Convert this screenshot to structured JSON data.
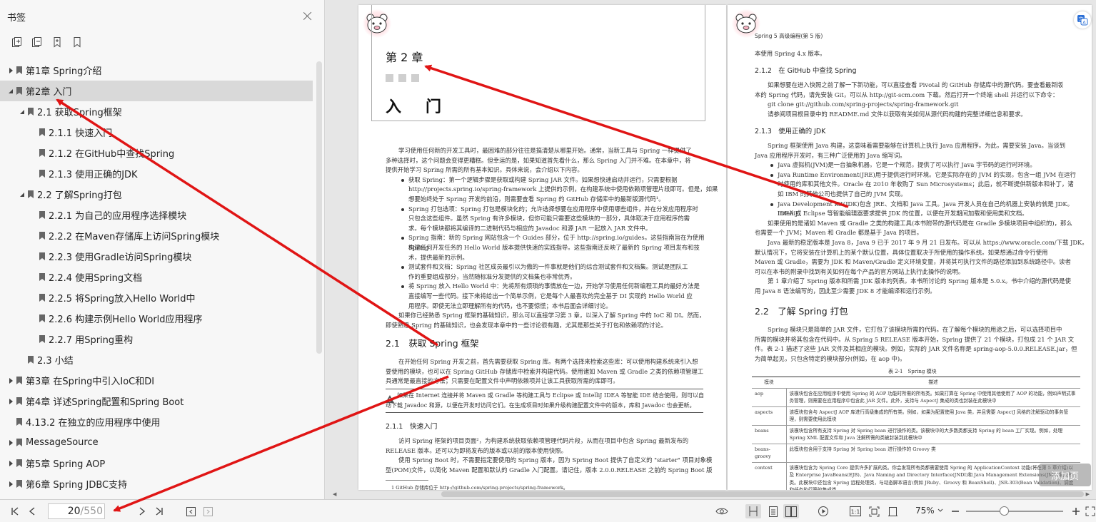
{
  "sidebar": {
    "title": "书签",
    "items": [
      {
        "label": "第1章 Spring介绍",
        "level": 0,
        "caret": "right"
      },
      {
        "label": "第2章 入门",
        "level": 0,
        "caret": "down",
        "selected": true
      },
      {
        "label": "2.1 获取Spring框架",
        "level": 1,
        "caret": "down"
      },
      {
        "label": "2.1.1 快速入门",
        "level": 2,
        "caret": ""
      },
      {
        "label": "2.1.2 在GitHub中查找Spring",
        "level": 2,
        "caret": ""
      },
      {
        "label": "2.1.3 使用正确的JDK",
        "level": 2,
        "caret": ""
      },
      {
        "label": "2.2 了解Spring打包",
        "level": 1,
        "caret": "down"
      },
      {
        "label": "2.2.1 为自己的应用程序选择模块",
        "level": 2,
        "caret": ""
      },
      {
        "label": "2.2.2 在Maven存储库上访问Spring模块",
        "level": 2,
        "caret": ""
      },
      {
        "label": "2.2.3 使用Gradle访问Spring模块",
        "level": 2,
        "caret": ""
      },
      {
        "label": "2.2.4 使用Spring文档",
        "level": 2,
        "caret": ""
      },
      {
        "label": "2.2.5 将Spring放入Hello World中",
        "level": 2,
        "caret": ""
      },
      {
        "label": "2.2.6 构建示例Hello World应用程序",
        "level": 2,
        "caret": ""
      },
      {
        "label": "2.2.7 用Spring重构",
        "level": 2,
        "caret": ""
      },
      {
        "label": "2.3 小结",
        "level": 1,
        "caret": ""
      },
      {
        "label": "第3章 在Spring中引入IoC和DI",
        "level": 0,
        "caret": "right"
      },
      {
        "label": "第4章 详述Spring配置和Spring Boot",
        "level": 0,
        "caret": "right"
      },
      {
        "label": "4.13.2 在独立的应用程序中使用",
        "level": 0.5,
        "caret": ""
      },
      {
        "label": "MessageSource",
        "level": 0,
        "caret": "right"
      },
      {
        "label": "第5章 Spring AOP",
        "level": 0,
        "caret": "right"
      },
      {
        "label": "第6章 Spring JDBC支持",
        "level": 0,
        "caret": "right"
      }
    ]
  },
  "left_page": {
    "chapter_no": "第 2 章",
    "chapter_title": "入门",
    "intro": [
      "学习使用任何新的开发工具时，最困难的部分往往是搞清楚从哪里开始。通常，当新工具与 Spring 一样提供了",
      "多种选择时，这个问题会变得更糟糕。但幸运的是，如果知道首先看什么，那么 Spring 入门并不难。在本章中，将",
      "提供开始学习 Spring 所需的所有基本知识。具体来说，会介绍以下内容。"
    ],
    "bullets": [
      [
        "获取 Spring：第一个逻辑步骤是获取或构建 Spring JAR 文件。如果想快速启动并运行，只需要根据",
        "http://projects.spring.io/spring-framework 上提供的示例，在构建系统中使用依赖项管理片段即可。但是，如果",
        "想要始终处于 Spring 开发的前沿，则需要查看 Spring 的 GitHub 存储库中的最新版源代码¹。"
      ],
      [
        "Spring 打包选项：Spring 打包是模块化的；允许选择想要在应用程序中使用哪些组件，并在分发应用程序时",
        "只包含这些组件。虽然 Spring 有许多模块，但你可能只需要这些模块的一部分，具体取决于应用程序的需",
        "求。每个模块都将其编译的二进制代码与相应的 Javadoc 和源 JAR 一起放入 JAR 文件中。"
      ],
      [
        "Spring 指南：新的 Spring 网站包含一个 Guides 部分，位于 http://spring.io/guides。这些指南旨在为使用 Spring",
        "构建任何开发任务的 Hello World 版本提供快速的实践指导。这些指南还反映了最新的 Spring 项目发布和技",
        "术，提供最新的示例。"
      ],
      [
        "测试套件和文档：Spring 社区成员最引以为傲的一件事就是他们的综合测试套件和文档集。测试是团队工",
        "作的重要组成部分，当然随标准分发提供的文档集也非常优秀。"
      ],
      [
        "将 Spring 放入 Hello World 中：先将所有烦琐的事情放在一边，开始学习使用任何新编程工具的最好方法是",
        "直接编写一些代码。接下来将给出一个简单示例，它是每个人最喜欢的完全基于 DI 实现的 Hello World 应",
        "用程序。即使无法立即理解所有的代码，也不要惊慌；本书后面会详细讨论。"
      ]
    ],
    "outro": [
      "如果你已经熟悉 Spring 框架的基础知识，那么可以直接学习第 3 章，以深入了解 Spring 中的 IoC 和 DI。然而，",
      "即使熟悉 Spring 的基础知识，也会发现本章中的一些讨论很有趣，尤其是那些关于打包和依赖项的讨论。"
    ],
    "h_21": "2.1　获取 Spring 框架",
    "p_21": [
      "在开始任何 Spring 开发之前，首先需要获取 Spring 库。有两个选择来检索这些库：可以使用构建系统来引入想",
      "要使用的模块，也可以在 Spring GitHub 存储库中检索并构建代码。使用诸如 Maven 或 Gradle 之类的依赖项管理工",
      "具通常是最直接的方法；只需要在配置文件中声明依赖项并让该工具获取所需的库即可。"
    ],
    "note": [
      "如果在 Internet 连接并将 Maven 或 Gradle 等构建工具与 Eclipse 或 IntelliJ IDEA 等智能 IDE 结合使用，则可以自",
      "动下载 Javadoc 和源，以便在开发时访问它们。在生成项目时如果升级构建配置文件中的版本，库和 Javadoc 也会更新。"
    ],
    "h_211": "2.1.1　快速入门",
    "p_211": [
      "访问 Spring 框架的项目页面²，为构建系统获取依赖项管理代码片段，从而在项目中包含 Spring 最新发布的",
      "RELEASE 版本。还可以为即将发布的版本或以前的版本使用快照。",
      "使用 Spring Boot 时，不需要指定要使用的 Spring 版本，因为 Spring Boot 提供了自定义的 \"starter\" 项目对象模",
      "型(POM)文件，以简化 Maven 配置和默认的 Gradle 入门配置。请记住，版本 2.0.0.RELEASE 之前的 Spring Boot 版"
    ],
    "footnote": "1  GitHub 存储库位于 http://github.com/spring-projects/spring-framework。"
  },
  "right_page": {
    "header": "Spring 5 高级编程(第 5 版)",
    "top_line": "本使用 Spring 4.x 版本。",
    "h_212": "2.1.2　在 GitHub 中查找 Spring",
    "p_212": [
      "如果想要在进入快照之前了解一下新功能，可以直接查看 Pivotal 的 GitHub 存储库中的源代码。要查看最新版",
      "本的 Spring 代码，请先安装 Git，可以从 http://git-scm.com 下载。然后打开一个终端 shell 并运行以下命令：",
      "git clone git://github.com/spring-projects/spring-framework.git",
      "请参阅项目根目录中的 README.md 文件以获取有关如何从源代码构建的完整详细信息和要求。"
    ],
    "h_213": "2.1.3　使用正确的 JDK",
    "p_213a": [
      "Spring 框架使用 Java 构建，这意味着需要能够在计算机上执行 Java 应用程序。为此，需要安装 Java。当谈到",
      "Java 应用程序开发时，有三种广泛使用的 Java 缩写词。"
    ],
    "bullets": [
      [
        "Java 虚拟机(JVM)是一台抽象机器。它是一个规范，提供了可以执行 Java 字节码的运行时环境。"
      ],
      [
        "Java Runtime Environment(JRE)用于提供运行时环境。它是实际存在的 JVM 的实现，包含一组 JVM 在运行",
        "时使用的库和其他文件。Oracle 在 2010 年收购了 Sun Microsystems；此后，就不断提供新版本和补丁，诸",
        "如 IBM 的其他公司也提供了自己的 JVM 实现。"
      ],
      [
        "Java Development Kit(JDK)包含 JRE、文档和 Java 工具。Java 开发人员在自己的机器上安装的就是 JDK。IntelliJ",
        "IDEA 或 Eclipse 等智能编辑器要求提供 JDK 的位置，以便在开发期间加载和使用类和文档。"
      ]
    ],
    "p_213b": [
      "如果使用的是诸如 Maven 或 Gradle 之类的构建工具(本书附带的源代码是在 Gradle 多模块项目中组织的)，那么",
      "也需要一个 JVM；Maven 和 Gradle 都是基于 Java 的项目。",
      "Java 最新的稳定版本是 Java 8，Java 9 已于 2017 年 9 月 21 日发布。可以从 https://www.oracle.com/下载 JDK。",
      "默认情况下，它将安装在计算机上的某个默认位置，具体位置取决于所使用的操作系统。如果想通过命令行使用",
      "Maven 或 Gradle，需要为 JDK 和 Maven/Gradle 定义环境变量，并将其可执行文件的路径添加到系统路径中。读者",
      "可以在本书的附录中找到有关如何在每个产品的官方网站上执行此操作的说明。",
      "第 1 章介绍了 Spring 版本和所需 JDK 版本的列表。本书所讨论的 Spring 版本是 5.0.x。书中介绍的源代码是使",
      "用 Java 8 语法编写的，因此至少需要 JDK 8 才能编译和运行示例。"
    ],
    "h_22": "2.2　了解 Spring 打包",
    "p_22": [
      "Spring 模块只是简单的 JAR 文件，它打包了该模块所需的代码。在了解每个模块的用途之后，可以选择项目中",
      "所需的模块并将其包含在代码中。从 Spring 5 RELEASE 版本开始，Spring 提供了 21 个模块，打包成 21 个 JAR 文",
      "件。表 2-1 描述了这些 JAR 文件及其相应的模块。例如，实际的 JAR 文件名称是 spring-aop-5.0.0.RELEASE.jar，但",
      "为简单起见，只包含特定的模块部分(例如，在 aop 中)。"
    ],
    "table_caption": "表 2-1　Spring 模块",
    "table_headers": [
      "模块",
      "描述"
    ],
    "table_rows": [
      [
        "aop",
        "该模块包含在应用程序中使用 Spring 的 AOP 功能时所需的所有类。如果打算在 Spring 中使用其他使用了 AOP 的功能，例如声明式事务管理，则需要在应用程序中包含此 JAR 文件。此外，支持与 AspectJ 集成的类也封装在此模块中"
      ],
      [
        "aspects",
        "该模块包含与 AspectJ AOP 库进行高级集成的所有类。例如，如果为配置使用 Java 类，并且需要 AspectJ 风格的注解驱动的事务管理，则需要使用此模块"
      ],
      [
        "beans",
        "该模块包含所有支持 Spring 对 Spring bean 进行操作的类。该模块中的大多数类都支持 Spring 的 bean 工厂实现。例如，处理 Spring XML 配置文件和 Java 注解所需的类被封装到此模块中"
      ],
      [
        "beans-groovy",
        "此模块包含用于支持 Spring 对 Spring bean 进行操作的 Groovy 类"
      ],
      [
        "context",
        "该模块包含为 Spring Core 提供许多扩展的类。你会发现所有类都需要使用 Spring 的 ApplicationContext 功能(将在第 5 章介绍)以及 Enterprise JavaBeans(EJB)、Java Naming and Directory Interface(JNDI)和 Java Management Extensions(JMX)集成的类。此模块中还包含 Spring 远程处理类，与动态脚本语言(例如 JRuby、Groovy 和 BeanShell)、JSR-303(Bean Validation)、调度和任务执行等的集成类"
      ]
    ]
  },
  "float_badge": "添加页",
  "toolbar": {
    "page_current": "20",
    "page_total": "/550",
    "zoom": "75%"
  },
  "colors": {
    "annotation_arrow": "#e01515",
    "selected_row": "#d9d9d9",
    "sidebar_bg": "#f7f7f7",
    "fab_icon": "#2b6fd6"
  }
}
